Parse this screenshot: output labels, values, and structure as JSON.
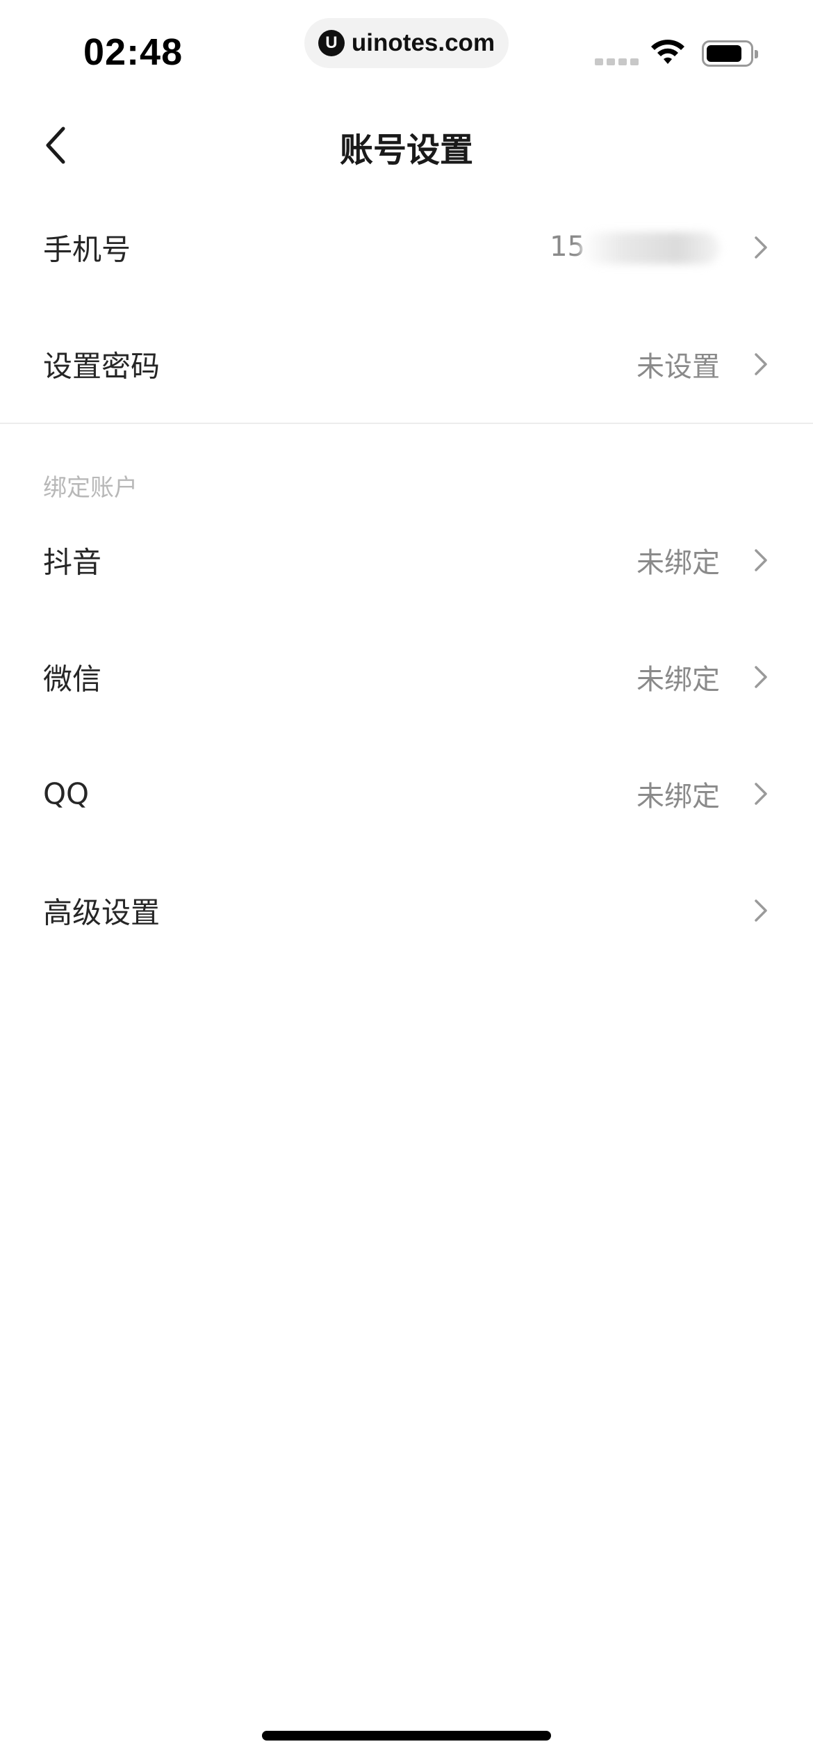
{
  "status_bar": {
    "time": "02:48",
    "url_logo": "U",
    "url": "uinotes.com"
  },
  "header": {
    "title": "账号设置",
    "back_icon": "chevron-left-icon"
  },
  "account": {
    "phone": {
      "label": "手机号",
      "value_visible": "15"
    },
    "password": {
      "label": "设置密码",
      "value": "未设置"
    }
  },
  "bind_section": {
    "title": "绑定账户",
    "items": [
      {
        "label": "抖音",
        "value": "未绑定"
      },
      {
        "label": "微信",
        "value": "未绑定"
      },
      {
        "label": "QQ",
        "value": "未绑定"
      }
    ]
  },
  "advanced": {
    "label": "高级设置"
  },
  "icons": {
    "row_arrow": "chevron-right-icon"
  },
  "colors": {
    "background": "#ffffff",
    "label": "#262626",
    "value": "#8a8a8a",
    "section_label": "#b8b8b8",
    "divider": "#ececec"
  }
}
